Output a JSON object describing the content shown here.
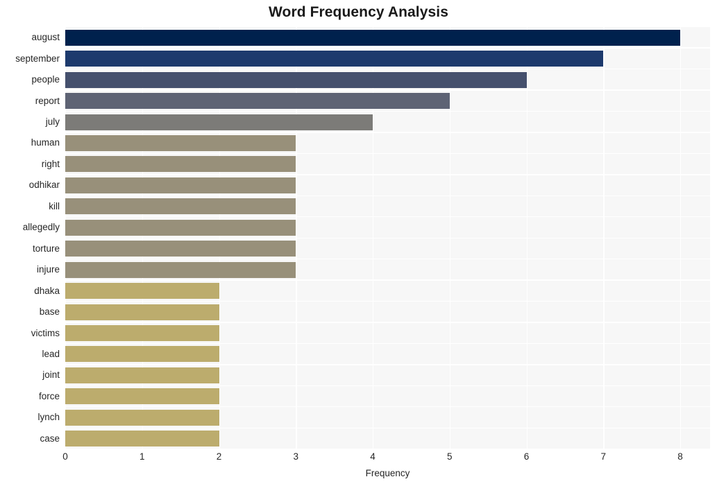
{
  "chart_data": {
    "type": "bar",
    "orientation": "horizontal",
    "title": "Word Frequency Analysis",
    "xlabel": "Frequency",
    "ylabel": "",
    "xlim": [
      0,
      8
    ],
    "xticks": [
      0,
      1,
      2,
      3,
      4,
      5,
      6,
      7,
      8
    ],
    "xtick_labels": [
      "0",
      "1",
      "2",
      "3",
      "4",
      "5",
      "6",
      "7",
      "8"
    ],
    "grid": true,
    "grid_color": "#ffffff",
    "plot_background": "#f7f7f7",
    "figure_background": "#ffffff",
    "legend": null,
    "categories": [
      "august",
      "september",
      "people",
      "report",
      "july",
      "human",
      "right",
      "odhikar",
      "kill",
      "allegedly",
      "torture",
      "injure",
      "dhaka",
      "base",
      "victims",
      "lead",
      "joint",
      "force",
      "lynch",
      "case"
    ],
    "values": [
      8,
      7,
      6,
      5,
      4,
      3,
      3,
      3,
      3,
      3,
      3,
      3,
      2,
      2,
      2,
      2,
      2,
      2,
      2,
      2
    ],
    "bar_colors": [
      "#00214d",
      "#1d3a6d",
      "#45506d",
      "#5e6374",
      "#7c7b78",
      "#98907a",
      "#98907a",
      "#98907a",
      "#98907a",
      "#98907a",
      "#98907a",
      "#98907a",
      "#bcac6d",
      "#bcac6d",
      "#bcac6d",
      "#bcac6d",
      "#bcac6d",
      "#bcac6d",
      "#bcac6d",
      "#bcac6d"
    ],
    "colormap": "cividis"
  }
}
